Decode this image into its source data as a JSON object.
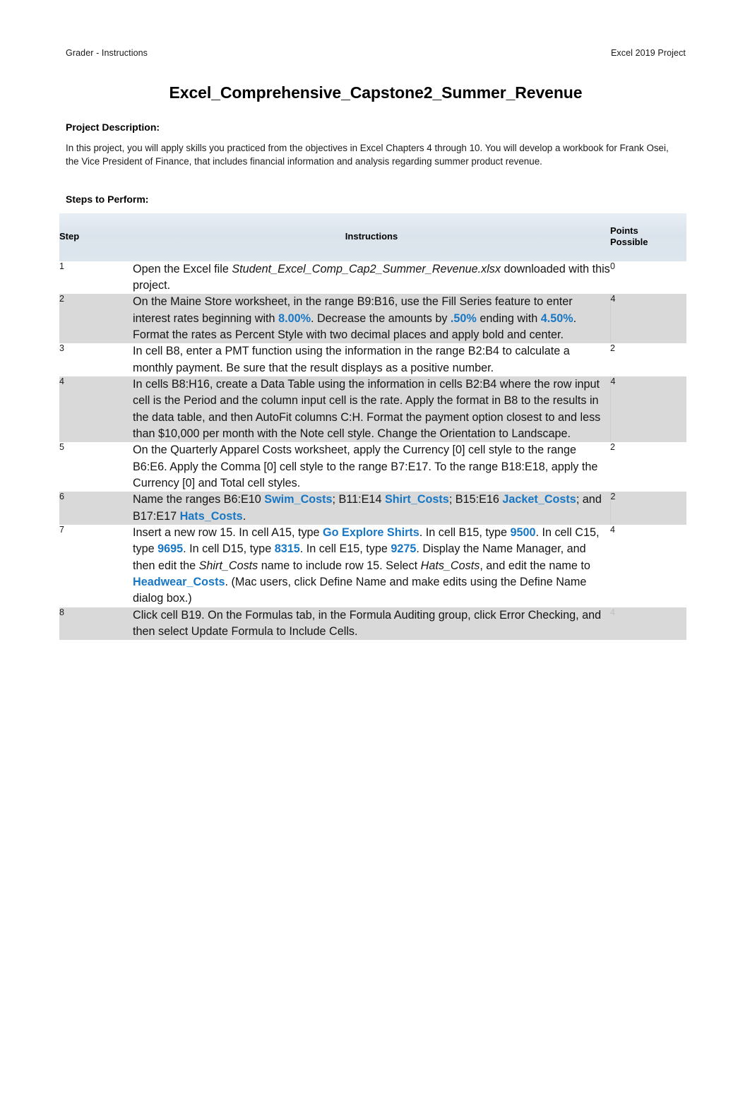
{
  "header": {
    "left": "Grader - Instructions",
    "right": "Excel 2019 Project"
  },
  "title": "Excel_Comprehensive_Capstone2_Summer_Revenue",
  "description": {
    "label": "Project Description:",
    "body": "In this project, you will apply skills you practiced from the objectives in Excel Chapters 4 through 10. You will develop a workbook for Frank Osei, the Vice President of Finance, that includes financial information and analysis regarding summer product revenue."
  },
  "steps_label": "Steps to Perform:",
  "table": {
    "columns": [
      "Step",
      "Instructions",
      "Points\nPossible"
    ],
    "column_step": "Step",
    "column_instructions": "Instructions",
    "column_points_line1": "Points",
    "column_points_line2": "Possible",
    "rows": [
      {
        "step": "1",
        "points": "0",
        "shaded": false,
        "parts": [
          {
            "text": "Open the Excel file ",
            "style": "normal"
          },
          {
            "text": "Student_Excel_Comp_Cap2_Summer_Revenue.xlsx",
            "style": "italic"
          },
          {
            "text": " downloaded with this project.",
            "style": "normal"
          }
        ]
      },
      {
        "step": "2",
        "points": "4",
        "shaded": true,
        "parts": [
          {
            "text": "On the Maine Store worksheet, in the range B9:B16, use the Fill Series feature to enter interest rates beginning with ",
            "style": "normal"
          },
          {
            "text": "8.00%",
            "style": "highlight"
          },
          {
            "text": ". Decrease the amounts by ",
            "style": "normal"
          },
          {
            "text": ".50%",
            "style": "highlight"
          },
          {
            "text": " ending with ",
            "style": "normal"
          },
          {
            "text": "4.50%",
            "style": "highlight"
          },
          {
            "text": ". Format the rates as Percent Style with two decimal places and apply bold and center.",
            "style": "normal"
          }
        ]
      },
      {
        "step": "3",
        "points": "2",
        "shaded": false,
        "parts": [
          {
            "text": "In cell B8, enter a PMT function using the information in the range B2:B4 to calculate a monthly payment. Be sure that the result displays as a positive number.",
            "style": "normal"
          }
        ]
      },
      {
        "step": "4",
        "points": "4",
        "shaded": true,
        "parts": [
          {
            "text": "In cells B8:H16, create a Data Table using the information in cells B2:B4 where the row input cell is the Period and the column input cell is the rate. Apply the format in B8 to the results in the data table, and then AutoFit columns C:H. Format the payment option closest to and less than $10,000 per month with the Note cell style. Change the Orientation to Landscape.",
            "style": "normal"
          }
        ]
      },
      {
        "step": "5",
        "points": "2",
        "shaded": false,
        "parts": [
          {
            "text": "On the Quarterly Apparel Costs worksheet, apply the Currency [0] cell style to the range B6:E6. Apply the Comma [0] cell style to the range B7:E17. To the range B18:E18, apply the Currency [0] and Total cell styles.",
            "style": "normal"
          }
        ]
      },
      {
        "step": "6",
        "points": "2",
        "shaded": true,
        "parts": [
          {
            "text": "Name the ranges B6:E10 ",
            "style": "normal"
          },
          {
            "text": "Swim_Costs",
            "style": "highlight"
          },
          {
            "text": "; B11:E14 ",
            "style": "normal"
          },
          {
            "text": "Shirt_Costs",
            "style": "highlight"
          },
          {
            "text": "; B15:E16 ",
            "style": "normal"
          },
          {
            "text": "Jacket_Costs",
            "style": "highlight"
          },
          {
            "text": "; and B17:E17 ",
            "style": "normal"
          },
          {
            "text": "Hats_Costs",
            "style": "highlight"
          },
          {
            "text": ".",
            "style": "normal"
          }
        ]
      },
      {
        "step": "7",
        "points": "4",
        "shaded": false,
        "parts": [
          {
            "text": "Insert a new row 15. In cell A15, type ",
            "style": "normal"
          },
          {
            "text": "Go Explore Shirts",
            "style": "highlight"
          },
          {
            "text": ". In cell B15, type ",
            "style": "normal"
          },
          {
            "text": "9500",
            "style": "highlight"
          },
          {
            "text": ". In cell C15, type ",
            "style": "normal"
          },
          {
            "text": "9695",
            "style": "highlight"
          },
          {
            "text": ". In cell D15, type ",
            "style": "normal"
          },
          {
            "text": "8315",
            "style": "highlight"
          },
          {
            "text": ". In cell E15, type ",
            "style": "normal"
          },
          {
            "text": "9275",
            "style": "highlight"
          },
          {
            "text": ". Display the Name Manager, and then edit the ",
            "style": "normal"
          },
          {
            "text": "Shirt_Costs",
            "style": "italic"
          },
          {
            "text": " name to include row 15. Select ",
            "style": "normal"
          },
          {
            "text": "Hats_Costs",
            "style": "italic"
          },
          {
            "text": ", and edit the name to ",
            "style": "normal"
          },
          {
            "text": "Headwear_Costs",
            "style": "highlight"
          },
          {
            "text": ". (Mac users, click Define Name and make edits using the Define Name dialog box.)",
            "style": "normal"
          }
        ]
      },
      {
        "step": "8",
        "points": "4",
        "shaded": true,
        "faded": true,
        "parts": [
          {
            "text": "Click cell B19. On the Formulas tab, in the Formula Auditing group, click Error Checking, and then select Update Formula to Include Cells.",
            "style": "normal"
          }
        ]
      }
    ]
  },
  "footer": {
    "left": "",
    "center": "",
    "right": ""
  },
  "colors": {
    "highlight_blue": "#1877c4",
    "header_fill": "#dbe3ec",
    "row_shaded": "#d9d9d9"
  }
}
